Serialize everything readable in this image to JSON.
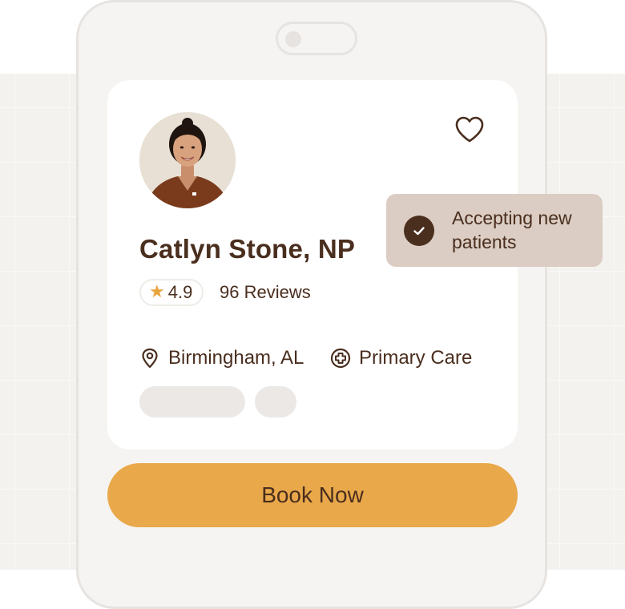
{
  "provider": {
    "name": "Catlyn Stone, NP",
    "rating": "4.9",
    "reviews_label": "96 Reviews",
    "location": "Birmingham, AL",
    "specialty": "Primary Care"
  },
  "badge": {
    "label": "Accepting new patients"
  },
  "actions": {
    "book_label": "Book Now"
  },
  "icons": {
    "favorite": "heart-icon",
    "rating": "star-icon",
    "location": "map-pin-icon",
    "specialty": "medical-cross-icon",
    "badge": "check-circle-icon"
  },
  "colors": {
    "text": "#4a2e1e",
    "accent": "#e9a84a",
    "star": "#e8a53f",
    "badge_bg": "#dbcdc3",
    "card_bg": "#ffffff",
    "page_bg": "#f4f2ef"
  }
}
